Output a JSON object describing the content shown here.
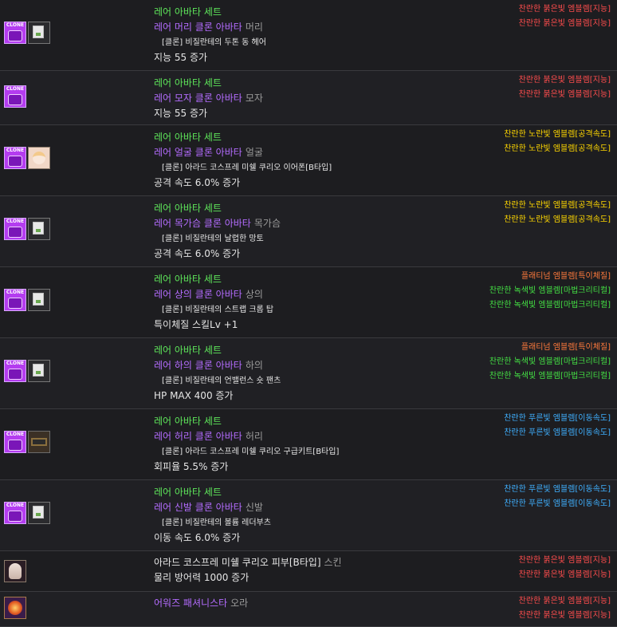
{
  "rows": [
    {
      "set": "레어 아바타 세트",
      "name": "레어 머리 클론 아바타",
      "slot": "머리",
      "clone": "[클론] 비질란테의 두톤 동 헤어",
      "stat": "지능 55 증가",
      "icon2": "broken",
      "emblems": [
        {
          "text": "찬란한 붉은빛 엠블렘[지능]",
          "color": "#ff4d4d"
        },
        {
          "text": "찬란한 붉은빛 엠블렘[지능]",
          "color": "#ff4d4d"
        }
      ]
    },
    {
      "set": "레어 아바타 세트",
      "name": "레어 모자 클론 아바타",
      "slot": "모자",
      "clone": "",
      "stat": "지능 55 증가",
      "icon2": "",
      "emblems": [
        {
          "text": "찬란한 붉은빛 엠블렘[지능]",
          "color": "#ff4d4d"
        },
        {
          "text": "찬란한 붉은빛 엠블렘[지능]",
          "color": "#ff4d4d"
        }
      ]
    },
    {
      "set": "레어 아바타 세트",
      "name": "레어 얼굴 클론 아바타",
      "slot": "얼굴",
      "clone": "[클론] 아라드 코스프레 미쉘 쿠리오 이어폰[B타입]",
      "stat": "공격 속도 6.0% 증가",
      "icon2": "face",
      "emblems": [
        {
          "text": "찬란한 노란빛 엠블렘[공격속도]",
          "color": "#ffd700"
        },
        {
          "text": "찬란한 노란빛 엠블렘[공격속도]",
          "color": "#ffd700"
        }
      ]
    },
    {
      "set": "레어 아바타 세트",
      "name": "레어 목가슴 클론 아바타",
      "slot": "목가슴",
      "clone": "[클론] 비질란테의 날렵한 망토",
      "stat": "공격 속도 6.0% 증가",
      "icon2": "broken",
      "emblems": [
        {
          "text": "찬란한 노란빛 엠블렘[공격속도]",
          "color": "#ffd700"
        },
        {
          "text": "찬란한 노란빛 엠블렘[공격속도]",
          "color": "#ffd700"
        }
      ]
    },
    {
      "set": "레어 아바타 세트",
      "name": "레어 상의 클론 아바타",
      "slot": "상의",
      "clone": "[클론] 비질란테의 스트랩 크롭 탑",
      "stat": "특이체질 스킬Lv +1",
      "icon2": "broken",
      "emblems": [
        {
          "text": "플래티넘 엠블렘[특이체질]",
          "color": "#ff7a3c"
        },
        {
          "text": "찬란한 녹색빛 엠블렘[마법크리티컬]",
          "color": "#44e044"
        },
        {
          "text": "찬란한 녹색빛 엠블렘[마법크리티컬]",
          "color": "#44e044"
        }
      ]
    },
    {
      "set": "레어 아바타 세트",
      "name": "레어 하의 클론 아바타",
      "slot": "하의",
      "clone": "[클론] 비질란테의 언밸런스 숏 팬츠",
      "stat": "HP MAX 400 증가",
      "icon2": "broken",
      "emblems": [
        {
          "text": "플래티넘 엠블렘[특이체질]",
          "color": "#ff7a3c"
        },
        {
          "text": "찬란한 녹색빛 엠블렘[마법크리티컬]",
          "color": "#44e044"
        },
        {
          "text": "찬란한 녹색빛 엠블렘[마법크리티컬]",
          "color": "#44e044"
        }
      ]
    },
    {
      "set": "레어 아바타 세트",
      "name": "레어 허리 클론 아바타",
      "slot": "허리",
      "clone": "[클론] 아라드 코스프레 미쉘 쿠리오 구급키트[B타입]",
      "stat": "회피율 5.5% 증가",
      "icon2": "belt",
      "emblems": [
        {
          "text": "찬란한 푸른빛 엠블렘[이동속도]",
          "color": "#3fb0ff"
        },
        {
          "text": "찬란한 푸른빛 엠블렘[이동속도]",
          "color": "#3fb0ff"
        }
      ]
    },
    {
      "set": "레어 아바타 세트",
      "name": "레어 신발 클론 아바타",
      "slot": "신발",
      "clone": "[클론] 비질란테의 볼륨 레더부츠",
      "stat": "이동 속도 6.0% 증가",
      "icon2": "broken",
      "emblems": [
        {
          "text": "찬란한 푸른빛 엠블렘[이동속도]",
          "color": "#3fb0ff"
        },
        {
          "text": "찬란한 푸른빛 엠블렘[이동속도]",
          "color": "#3fb0ff"
        }
      ]
    },
    {
      "set": "",
      "name": "아라드 코스프레 미쉘 쿠리오 피부[B타입]",
      "slot": "스킨",
      "clone": "",
      "stat": "물리 방어력 1000 증가",
      "icon2": "",
      "emblems": [
        {
          "text": "찬란한 붉은빛 엠블렘[지능]",
          "color": "#ff4d4d"
        },
        {
          "text": "찬란한 붉은빛 엠블렘[지능]",
          "color": "#ff4d4d"
        }
      ]
    },
    {
      "set": "",
      "name": "어워즈 패셔니스타",
      "slot": "오라",
      "clone": "",
      "stat": "",
      "icon2": "",
      "emblems": [
        {
          "text": "찬란한 붉은빛 엠블렘[지능]",
          "color": "#ff4d4d"
        },
        {
          "text": "찬란한 붉은빛 엠블렘[지능]",
          "color": "#ff4d4d"
        }
      ]
    }
  ]
}
